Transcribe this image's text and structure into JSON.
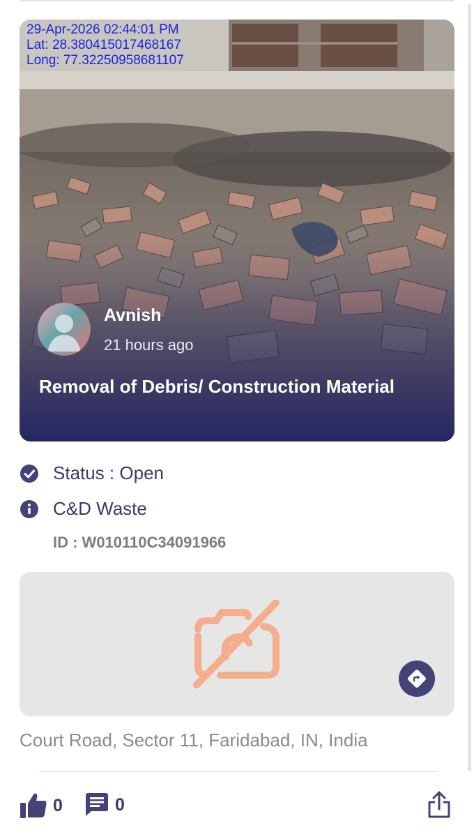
{
  "stamp": {
    "datetime": "29-Apr-2026 02:44:01 PM",
    "lat": "Lat: 28.380415017468167",
    "long": "Long: 77.32250958681107"
  },
  "post": {
    "author": "Avnish",
    "time_ago": "21 hours ago",
    "title": "Removal of Debris/ Construction Material"
  },
  "details": {
    "status": "Status : Open",
    "category": "C&D Waste",
    "id": "ID : W010110C34091966"
  },
  "location": {
    "address": "Court Road, Sector 11, Faridabad, IN, India"
  },
  "actions": {
    "likes": "0",
    "comments": "0"
  },
  "colors": {
    "accent": "#434378",
    "text_dark": "#3b3a66",
    "muted": "#8a8a8f",
    "no_photo_icon": "#f4ae8e",
    "stamp": "#1a22e6"
  },
  "icons": [
    "check-circle-icon",
    "info-icon",
    "camera-off-icon",
    "directions-icon",
    "thumbs-up-icon",
    "comment-icon",
    "share-icon"
  ]
}
